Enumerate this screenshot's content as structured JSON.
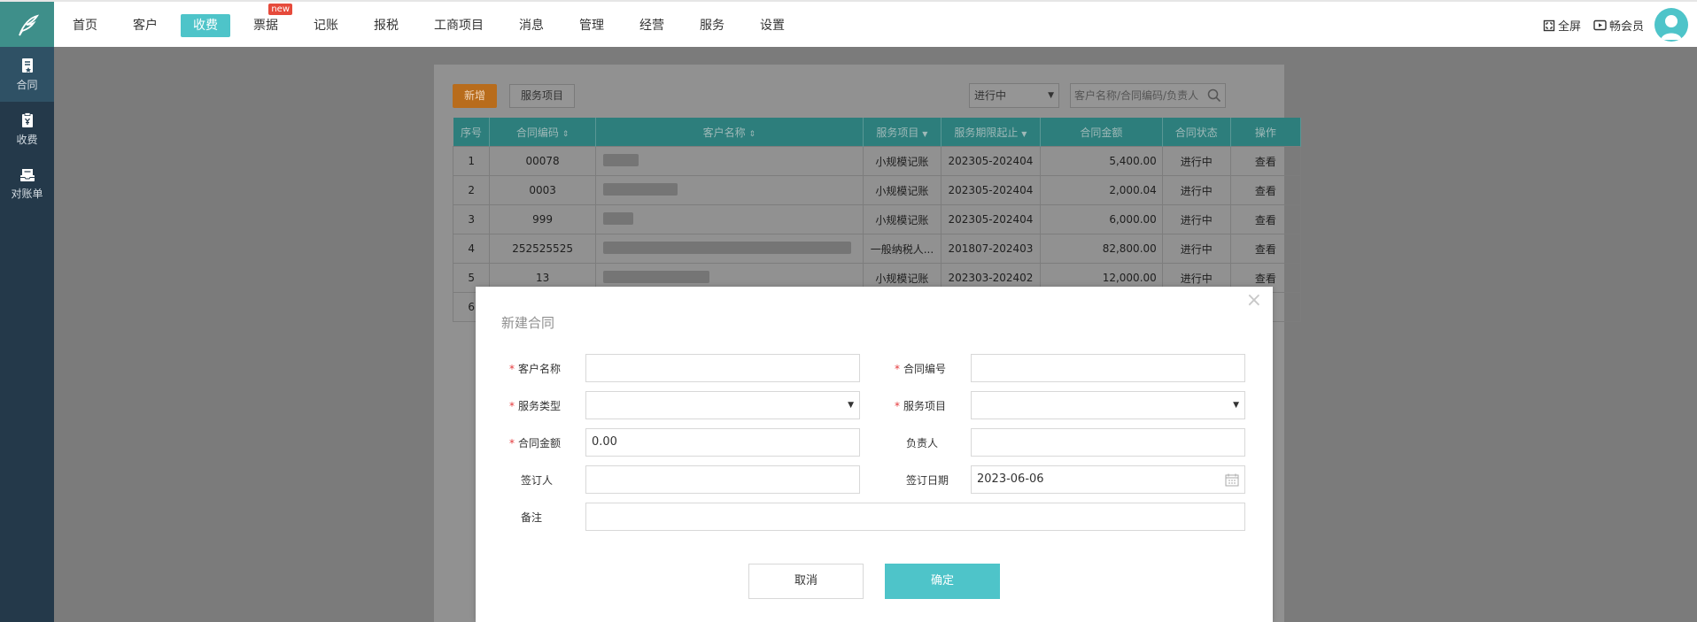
{
  "nav": {
    "items": [
      "首页",
      "客户",
      "收费",
      "票据",
      "记账",
      "报税",
      "工商项目",
      "消息",
      "管理",
      "经营",
      "服务",
      "设置"
    ],
    "new_badge": "new",
    "fullscreen": "全屏",
    "vip": "畅会员"
  },
  "sidebar": {
    "items": [
      "合同",
      "收费",
      "对账单"
    ]
  },
  "toolbar": {
    "add_label": "新增",
    "service_label": "服务项目",
    "status_value": "进行中",
    "search_placeholder": "客户名称/合同编码/负责人"
  },
  "table": {
    "headers": [
      "序号",
      "合同编码",
      "客户名称",
      "服务项目",
      "服务期限起止",
      "合同金额",
      "合同状态",
      "操作"
    ],
    "rows": [
      {
        "no": "1",
        "code": "00078",
        "service": "小规模记账",
        "period": "202305-202404",
        "amount": "5,400.00",
        "status": "进行中",
        "action": "查看"
      },
      {
        "no": "2",
        "code": "0003",
        "service": "小规模记账",
        "period": "202305-202404",
        "amount": "2,000.04",
        "status": "进行中",
        "action": "查看"
      },
      {
        "no": "3",
        "code": "999",
        "service": "小规模记账",
        "period": "202305-202404",
        "amount": "6,000.00",
        "status": "进行中",
        "action": "查看"
      },
      {
        "no": "4",
        "code": "252525525",
        "service": "一般纳税人...",
        "period": "201807-202403",
        "amount": "82,800.00",
        "status": "进行中",
        "action": "查看"
      },
      {
        "no": "5",
        "code": "13",
        "service": "小规模记账",
        "period": "202303-202402",
        "amount": "12,000.00",
        "status": "进行中",
        "action": "查看"
      },
      {
        "no": "6",
        "code": "",
        "service": "",
        "period": "",
        "amount": "",
        "status": "",
        "action": ""
      }
    ]
  },
  "modal": {
    "title": "新建合同",
    "close": "×",
    "customer_label": "客户名称",
    "contract_no_label": "合同编号",
    "service_type_label": "服务类型",
    "service_item_label": "服务项目",
    "amount_label": "合同金额",
    "amount_value": "0.00",
    "owner_label": "负责人",
    "signer_label": "签订人",
    "sign_date_label": "签订日期",
    "sign_date_value": "2023-06-06",
    "remark_label": "备注",
    "required_mark": "*",
    "cancel": "取消",
    "confirm": "确定"
  }
}
